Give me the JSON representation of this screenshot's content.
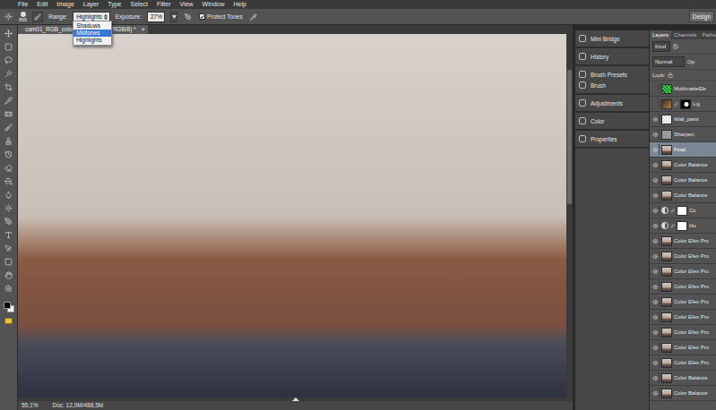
{
  "menu": [
    "File",
    "Edit",
    "Image",
    "Layer",
    "Type",
    "Select",
    "Filter",
    "View",
    "Window",
    "Help"
  ],
  "workspace_button": "Design",
  "options_bar": {
    "brush_size": "866",
    "range_label": "Range:",
    "range_value": "Highlights",
    "exposure_label": "Exposure:",
    "exposure_value": "27%",
    "protect_tones": {
      "label": "Protect Tones",
      "checked": true
    }
  },
  "range_menu": [
    {
      "label": "Shadows",
      "selected": false
    },
    {
      "label": "Midtones",
      "selected": true
    },
    {
      "label": "Highlights",
      "selected": false
    }
  ],
  "document_tab": {
    "title": "cam01_RGB_color.jpg @ 55,1% (RGB/8) *",
    "close": "×"
  },
  "status_bar": {
    "zoom": "55,1%",
    "doc": "Doc: 12,0M/488,5M"
  },
  "dock_groups": [
    [
      "Mini Bridge"
    ],
    [
      "History"
    ],
    [
      "Brush Presets",
      "Brush"
    ],
    [
      "Adjustments"
    ],
    [
      "Color"
    ],
    [
      "Properties"
    ]
  ],
  "layers_panel": {
    "tabs": [
      {
        "label": "Layers",
        "selected": true
      },
      {
        "label": "Channels",
        "selected": false
      },
      {
        "label": "Paths",
        "selected": false
      }
    ],
    "filter": "Kind",
    "blend_mode": "Normal",
    "opacity_label": "Op",
    "lock_label": "Lock:",
    "layers": [
      {
        "name": "MultimatteEle",
        "visible": false,
        "selected": false,
        "kind": "matte"
      },
      {
        "name": "Lig",
        "visible": false,
        "selected": false,
        "kind": "masked"
      },
      {
        "name": "Wall_paint",
        "visible": true,
        "selected": false,
        "kind": "blank"
      },
      {
        "name": "Sharpen",
        "visible": true,
        "selected": false,
        "kind": "fill"
      },
      {
        "name": "Final",
        "visible": true,
        "selected": true,
        "kind": "pixel"
      },
      {
        "name": "Color Balance",
        "visible": true,
        "selected": false,
        "kind": "pixel"
      },
      {
        "name": "Color Balance",
        "visible": true,
        "selected": false,
        "kind": "pixel"
      },
      {
        "name": "Color Balance",
        "visible": true,
        "selected": false,
        "kind": "pixel"
      },
      {
        "name": "Co",
        "visible": true,
        "selected": false,
        "kind": "adjustment"
      },
      {
        "name": "Hu",
        "visible": true,
        "selected": false,
        "kind": "adjustment"
      },
      {
        "name": "Color Efex Pro",
        "visible": true,
        "selected": false,
        "kind": "pixel"
      },
      {
        "name": "Color Efex Pro",
        "visible": true,
        "selected": false,
        "kind": "pixel"
      },
      {
        "name": "Color Efex Pro",
        "visible": true,
        "selected": false,
        "kind": "pixel"
      },
      {
        "name": "Color Efex Pro",
        "visible": true,
        "selected": false,
        "kind": "pixel"
      },
      {
        "name": "Color Efex Pro",
        "visible": true,
        "selected": false,
        "kind": "pixel"
      },
      {
        "name": "Color Efex Pro",
        "visible": true,
        "selected": false,
        "kind": "pixel"
      },
      {
        "name": "Color Efex Pro",
        "visible": true,
        "selected": false,
        "kind": "pixel"
      },
      {
        "name": "Color Efex Pro",
        "visible": true,
        "selected": false,
        "kind": "pixel"
      },
      {
        "name": "Color Efex Pro",
        "visible": true,
        "selected": false,
        "kind": "pixel"
      },
      {
        "name": "Color Balance",
        "visible": true,
        "selected": false,
        "kind": "pixel"
      },
      {
        "name": "Color Balance",
        "visible": true,
        "selected": false,
        "kind": "pixel"
      }
    ]
  }
}
